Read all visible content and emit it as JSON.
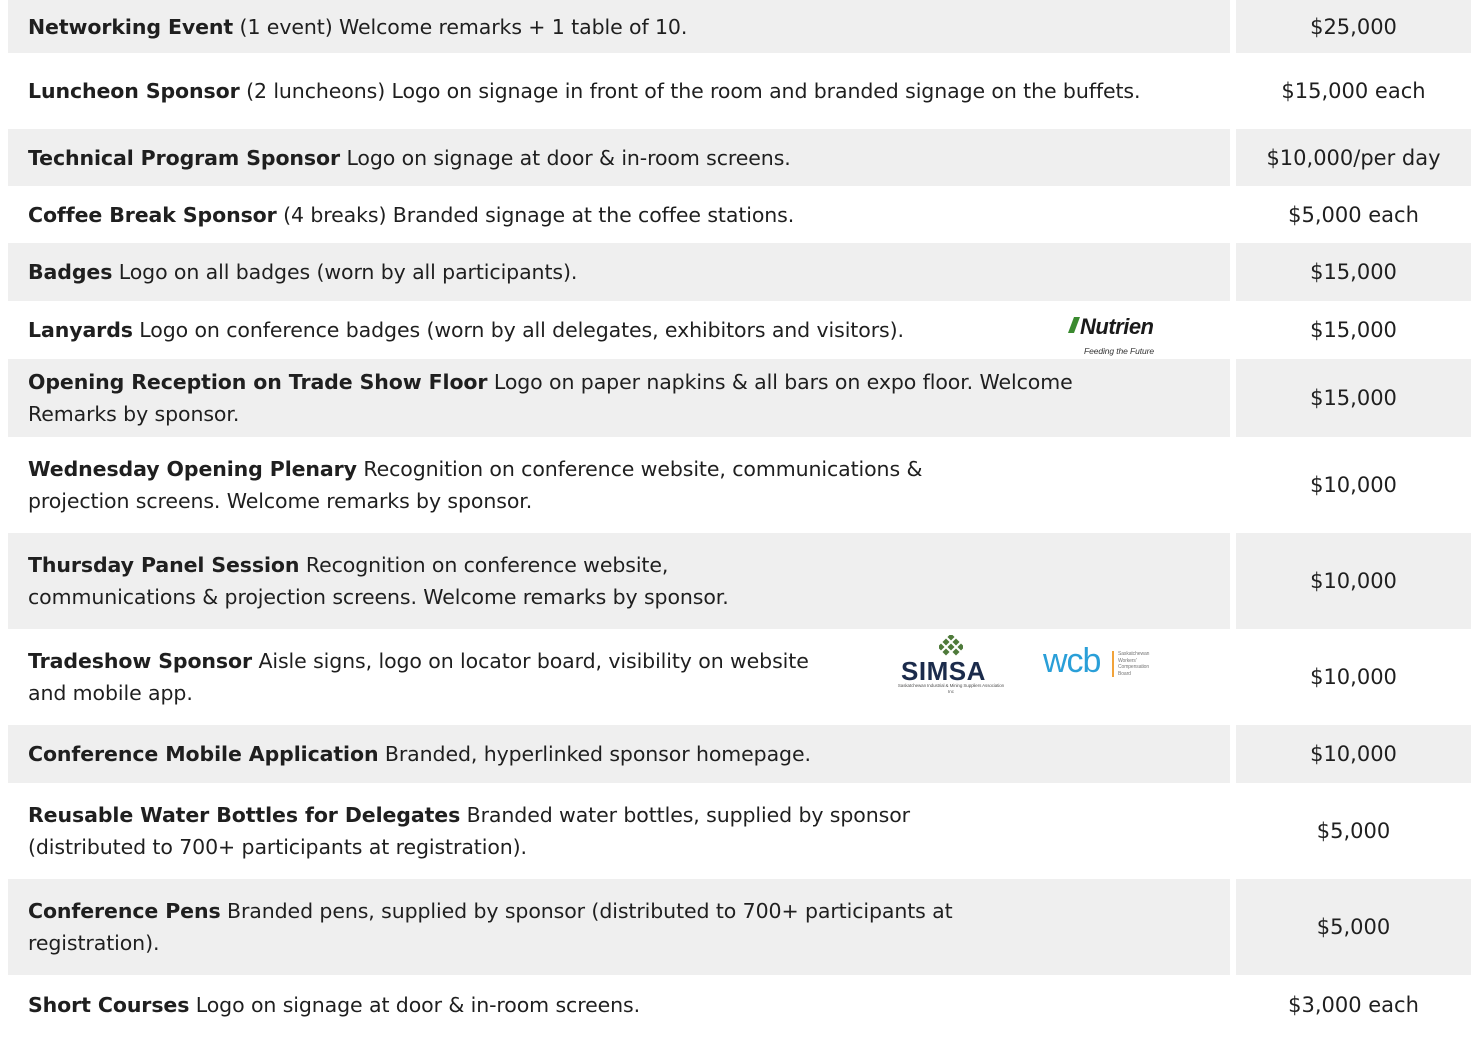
{
  "sponsorships": [
    {
      "title": "Networking Event",
      "description": "(1 event) Welcome remarks + 1 table of 10.",
      "price": "$25,000"
    },
    {
      "title": "Luncheon Sponsor",
      "description": "(2 luncheons) Logo on signage in front of the room and branded signage on the buffets.",
      "price": "$15,000 each"
    },
    {
      "title": "Technical Program Sponsor",
      "description": "Logo on signage at door & in-room screens.",
      "price": "$10,000/per day"
    },
    {
      "title": "Coffee Break Sponsor",
      "description": "(4 breaks) Branded signage at the coffee stations.",
      "price": "$5,000 each"
    },
    {
      "title": "Badges",
      "description": "Logo on all badges (worn by all participants).",
      "price": "$15,000"
    },
    {
      "title": "Lanyards",
      "description": "Logo on conference badges (worn by all delegates, exhibitors and visitors).",
      "price": "$15,000",
      "logos": [
        "nutrien"
      ]
    },
    {
      "title": "Opening Reception on Trade Show Floor",
      "description": "Logo on paper napkins & all bars on expo floor. Welcome Remarks by sponsor.",
      "price": "$15,000"
    },
    {
      "title": "Wednesday Opening Plenary",
      "description": "Recognition on conference website, communications & projection screens. Welcome remarks by sponsor.",
      "price": "$10,000"
    },
    {
      "title": "Thursday Panel Session",
      "description": "Recognition on conference website, communications & projection screens. Welcome remarks by sponsor.",
      "price": "$10,000"
    },
    {
      "title": "Tradeshow Sponsor",
      "description": "Aisle signs, logo on locator board, visibility on website and mobile app.",
      "price": "$10,000",
      "logos": [
        "simsa",
        "wcb"
      ]
    },
    {
      "title": "Conference Mobile Application",
      "description": "Branded, hyperlinked sponsor homepage.",
      "price": "$10,000"
    },
    {
      "title": "Reusable Water Bottles for Delegates",
      "description": "Branded water bottles, supplied by sponsor (distributed to 700+ participants at registration).",
      "price": "$5,000"
    },
    {
      "title": "Conference Pens",
      "description": "Branded pens, supplied by sponsor (distributed to 700+ participants at registration).",
      "price": "$5,000"
    },
    {
      "title": "Short Courses",
      "description": "Logo on signage at door & in-room screens.",
      "price": "$3,000 each"
    }
  ],
  "logos": {
    "nutrien": {
      "name": "Nutrien",
      "tagline": "Feeding the Future"
    },
    "simsa": {
      "name": "SIMSA",
      "subtitle": "Saskatchewan Industrial & Mining Suppliers Association Inc"
    },
    "wcb": {
      "name": "wcb",
      "subtitle": "Saskatchewan Workers' Compensation Board"
    }
  },
  "colors": {
    "row_shade": "#efefef",
    "text": "#1f1f1f",
    "nutrien_green": "#3a8a2f",
    "wcb_blue": "#2a9fd8",
    "simsa_navy": "#1b2b4b"
  }
}
